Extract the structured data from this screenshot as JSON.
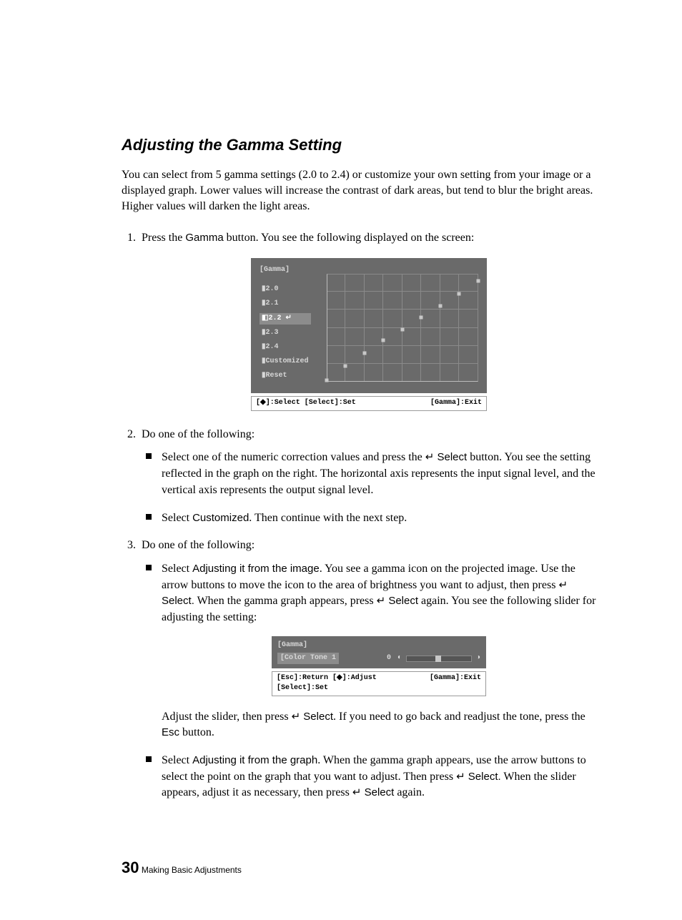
{
  "heading": "Adjusting the Gamma Setting",
  "intro": "You can select from 5 gamma settings (2.0 to 2.4) or customize your own setting from your image or a displayed graph. Lower values will increase the contrast of dark areas, but tend to blur the bright areas. Higher values will darken the light areas.",
  "step1_a": "Press the ",
  "step1_gamma": "Gamma",
  "step1_b": " button. You see the following displayed on the screen:",
  "osd": {
    "title": "[Gamma]",
    "items": [
      "▮2.0",
      "▮2.1",
      "◧2.2 ↵",
      "▮2.3",
      "▮2.4",
      "▮Customized",
      "▮Reset"
    ],
    "selected_index": 2,
    "status_left": "[◆]:Select [Select]:Set",
    "status_right": "[Gamma]:Exit"
  },
  "chart_data": {
    "type": "line",
    "x": [
      0,
      1,
      2,
      3,
      4,
      5,
      6,
      7,
      8
    ],
    "y": [
      0.1,
      0.9,
      1.6,
      2.3,
      2.9,
      3.6,
      4.2,
      4.9,
      5.6
    ],
    "xlim": [
      0,
      8
    ],
    "ylim": [
      0,
      6
    ],
    "xlabel": "input signal level",
    "ylabel": "output signal level"
  },
  "step2_lead": "Do one of the following:",
  "step2_bullets": {
    "b1_a": "Select one of the numeric correction values and press the ",
    "b1_sel": "↵ Select",
    "b1_b": " button. You see the setting reflected in the graph on the right. The horizontal axis represents the input signal level, and the vertical axis represents the output signal level.",
    "b2_a": "Select ",
    "b2_custom": "Customized",
    "b2_b": ". Then continue with the next step."
  },
  "step3_lead": "Do one of the following:",
  "step3_bullets": {
    "b1_a": "Select ",
    "b1_adj_img": "Adjusting it from the image",
    "b1_b": ". You see a gamma icon on the projected image. Use the arrow buttons to move the icon to the area of brightness you want to adjust, then press ",
    "b1_sel1": "↵ Select.",
    "b1_c": " When the gamma graph appears, press ",
    "b1_sel2": "↵ Select",
    "b1_d": " again. You see the following slider for adjusting the setting:",
    "b1_after_a": "Adjust the slider, then press ",
    "b1_after_sel": "↵ Select",
    "b1_after_b": ". If you need to go back and readjust the tone, press the ",
    "b1_after_esc": "Esc",
    "b1_after_c": " button.",
    "b2_a": "Select ",
    "b2_adj_graph": "Adjusting it from the graph",
    "b2_b": ". When the gamma graph appears, use the arrow buttons to select the point on the graph that you want to adjust. Then press ",
    "b2_sel1": "↵ Select.",
    "b2_c": " When the slider appears, adjust it as necessary, then press ",
    "b2_sel2": "↵ Select",
    "b2_d": " again."
  },
  "osd2": {
    "title": "[Gamma]",
    "label": "[Color Tone 1",
    "value": "0",
    "status_left": "[Esc]:Return [◆]:Adjust [Select]:Set",
    "status_right": "[Gamma]:Exit"
  },
  "footer": {
    "page": "30",
    "section": " Making Basic Adjustments"
  }
}
